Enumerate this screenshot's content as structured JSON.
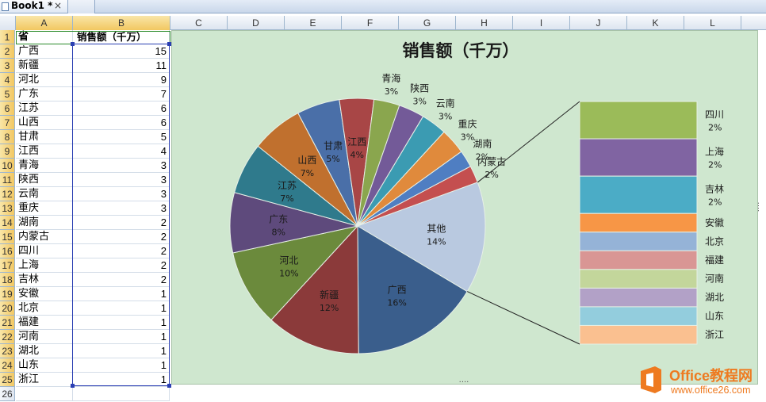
{
  "tab": {
    "title": "Book1 *",
    "close": "×"
  },
  "columns": [
    "A",
    "B",
    "C",
    "D",
    "E",
    "F",
    "G",
    "H",
    "I",
    "J",
    "K",
    "L"
  ],
  "rows": [
    "1",
    "2",
    "3",
    "4",
    "5",
    "6",
    "7",
    "8",
    "9",
    "10",
    "11",
    "12",
    "13",
    "14",
    "15",
    "16",
    "17",
    "18",
    "19",
    "20",
    "21",
    "22",
    "23",
    "24",
    "25",
    "26"
  ],
  "sheet": {
    "header": {
      "a": "省",
      "b": "销售额（千万）"
    },
    "data": [
      {
        "province": "广西",
        "sales": "15"
      },
      {
        "province": "新疆",
        "sales": "11"
      },
      {
        "province": "河北",
        "sales": "9"
      },
      {
        "province": "广东",
        "sales": "7"
      },
      {
        "province": "江苏",
        "sales": "6"
      },
      {
        "province": "山西",
        "sales": "6"
      },
      {
        "province": "甘肃",
        "sales": "5"
      },
      {
        "province": "江西",
        "sales": "4"
      },
      {
        "province": "青海",
        "sales": "3"
      },
      {
        "province": "陕西",
        "sales": "3"
      },
      {
        "province": "云南",
        "sales": "3"
      },
      {
        "province": "重庆",
        "sales": "3"
      },
      {
        "province": "湖南",
        "sales": "2"
      },
      {
        "province": "内蒙古",
        "sales": "2"
      },
      {
        "province": "四川",
        "sales": "2"
      },
      {
        "province": "上海",
        "sales": "2"
      },
      {
        "province": "吉林",
        "sales": "2"
      },
      {
        "province": "安徽",
        "sales": "1"
      },
      {
        "province": "北京",
        "sales": "1"
      },
      {
        "province": "福建",
        "sales": "1"
      },
      {
        "province": "河南",
        "sales": "1"
      },
      {
        "province": "湖北",
        "sales": "1"
      },
      {
        "province": "山东",
        "sales": "1"
      },
      {
        "province": "浙江",
        "sales": "1"
      }
    ]
  },
  "chart_data": {
    "type": "pie",
    "subtype": "pie-of-bar",
    "title": "销售额（千万）",
    "background": "#cfe7cf",
    "pie": [
      {
        "label": "广西",
        "pct": "16%",
        "value": 15,
        "color": "#3a5e8c"
      },
      {
        "label": "新疆",
        "pct": "12%",
        "value": 11,
        "color": "#8b3a3a"
      },
      {
        "label": "河北",
        "pct": "10%",
        "value": 9,
        "color": "#6b8a3c"
      },
      {
        "label": "广东",
        "pct": "8%",
        "value": 7,
        "color": "#5e4a7c"
      },
      {
        "label": "江苏",
        "pct": "7%",
        "value": 6,
        "color": "#2f7a8c"
      },
      {
        "label": "山西",
        "pct": "7%",
        "value": 6,
        "color": "#c0702e"
      },
      {
        "label": "甘肃",
        "pct": "5%",
        "value": 5,
        "color": "#4a6fa8"
      },
      {
        "label": "江西",
        "pct": "4%",
        "value": 4,
        "color": "#a84646"
      },
      {
        "label": "青海",
        "pct": "3%",
        "value": 3,
        "color": "#8aa64e"
      },
      {
        "label": "陕西",
        "pct": "3%",
        "value": 3,
        "color": "#735a98"
      },
      {
        "label": "云南",
        "pct": "3%",
        "value": 3,
        "color": "#3b9bb2"
      },
      {
        "label": "重庆",
        "pct": "3%",
        "value": 3,
        "color": "#e08a3c"
      },
      {
        "label": "湖南",
        "pct": "2%",
        "value": 2,
        "color": "#4f7ec2"
      },
      {
        "label": "内蒙古",
        "pct": "2%",
        "value": 2,
        "color": "#c44f4f"
      },
      {
        "label": "其他",
        "pct": "14%",
        "value": 13,
        "color": "#b9c9e0"
      }
    ],
    "bar": [
      {
        "label": "四川",
        "pct": "2%",
        "value": 2,
        "color": "#9bbb59"
      },
      {
        "label": "上海",
        "pct": "2%",
        "value": 2,
        "color": "#8064a2"
      },
      {
        "label": "吉林",
        "pct": "2%",
        "value": 2,
        "color": "#4bacc6"
      },
      {
        "label": "安徽",
        "pct": "",
        "value": 1,
        "color": "#f79646"
      },
      {
        "label": "北京",
        "pct": "",
        "value": 1,
        "color": "#95b3d7"
      },
      {
        "label": "福建",
        "pct": "",
        "value": 1,
        "color": "#d99694"
      },
      {
        "label": "河南",
        "pct": "",
        "value": 1,
        "color": "#c3d69b"
      },
      {
        "label": "湖北",
        "pct": "",
        "value": 1,
        "color": "#b2a1c7"
      },
      {
        "label": "山东",
        "pct": "",
        "value": 1,
        "color": "#93cddd"
      },
      {
        "label": "浙江",
        "pct": "",
        "value": 1,
        "color": "#fac090"
      }
    ]
  },
  "watermark": {
    "title": "Office教程网",
    "url": "www.office26.com",
    "logo_color": "#ee7a20"
  }
}
